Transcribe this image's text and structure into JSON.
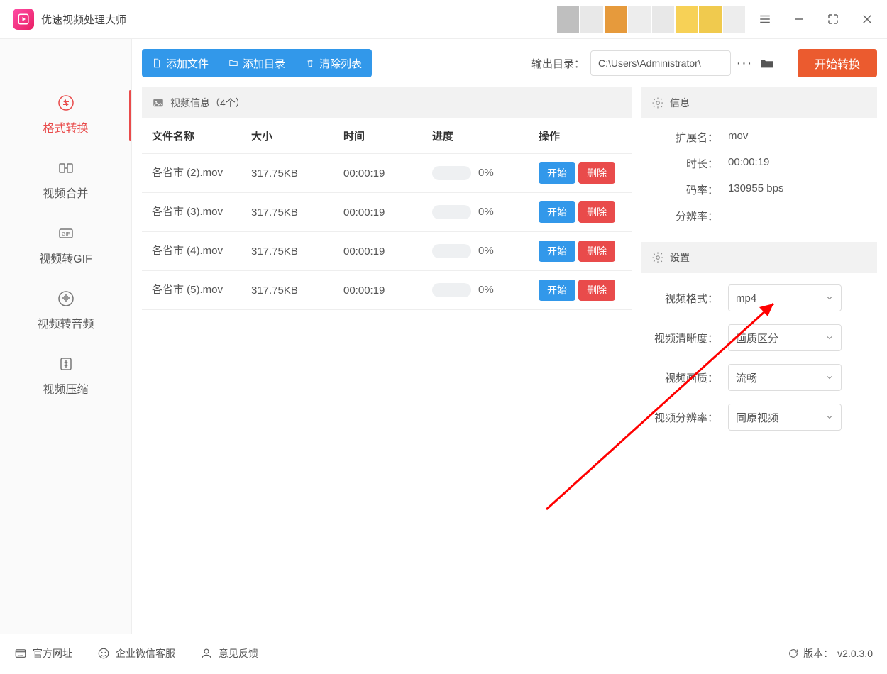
{
  "app": {
    "title": "优速视频处理大师"
  },
  "window": {
    "menu": "menu",
    "minimize": "min",
    "maximize": "max",
    "close": "close"
  },
  "sidebar": {
    "items": [
      {
        "label": "格式转换",
        "icon": "convert-icon"
      },
      {
        "label": "视频合并",
        "icon": "merge-icon"
      },
      {
        "label": "视频转GIF",
        "icon": "gif-icon"
      },
      {
        "label": "视频转音频",
        "icon": "audio-icon"
      },
      {
        "label": "视频压缩",
        "icon": "compress-icon"
      }
    ]
  },
  "toolbar": {
    "add_file": "添加文件",
    "add_folder": "添加目录",
    "clear_list": "清除列表",
    "output_label": "输出目录：",
    "output_path": "C:\\Users\\Administrator\\",
    "more": "···",
    "start_convert": "开始转换"
  },
  "table": {
    "header_title": "视频信息（4个）",
    "cols": {
      "name": "文件名称",
      "size": "大小",
      "time": "时间",
      "progress": "进度",
      "ops": "操作"
    },
    "start_label": "开始",
    "delete_label": "删除",
    "rows": [
      {
        "name": "各省市 (2).mov",
        "size": "317.75KB",
        "time": "00:00:19",
        "progress": "0%"
      },
      {
        "name": "各省市 (3).mov",
        "size": "317.75KB",
        "time": "00:00:19",
        "progress": "0%"
      },
      {
        "name": "各省市 (4).mov",
        "size": "317.75KB",
        "time": "00:00:19",
        "progress": "0%"
      },
      {
        "name": "各省市 (5).mov",
        "size": "317.75KB",
        "time": "00:00:19",
        "progress": "0%"
      }
    ]
  },
  "info": {
    "header": "信息",
    "ext_label": "扩展名：",
    "ext_value": "mov",
    "duration_label": "时长：",
    "duration_value": "00:00:19",
    "bitrate_label": "码率：",
    "bitrate_value": "130955 bps",
    "resolution_label": "分辨率：",
    "resolution_value": ""
  },
  "settings": {
    "header": "设置",
    "format_label": "视频格式：",
    "format_value": "mp4",
    "clarity_label": "视频清晰度：",
    "clarity_value": "画质区分",
    "quality_label": "视频画质：",
    "quality_value": "流畅",
    "resolution_label": "视频分辨率：",
    "resolution_value": "同原视频"
  },
  "footer": {
    "site": "官方网址",
    "support": "企业微信客服",
    "feedback": "意见反馈",
    "version_label": "版本：",
    "version": "v2.0.3.0"
  },
  "annotation": {
    "arrow": "arrow"
  }
}
